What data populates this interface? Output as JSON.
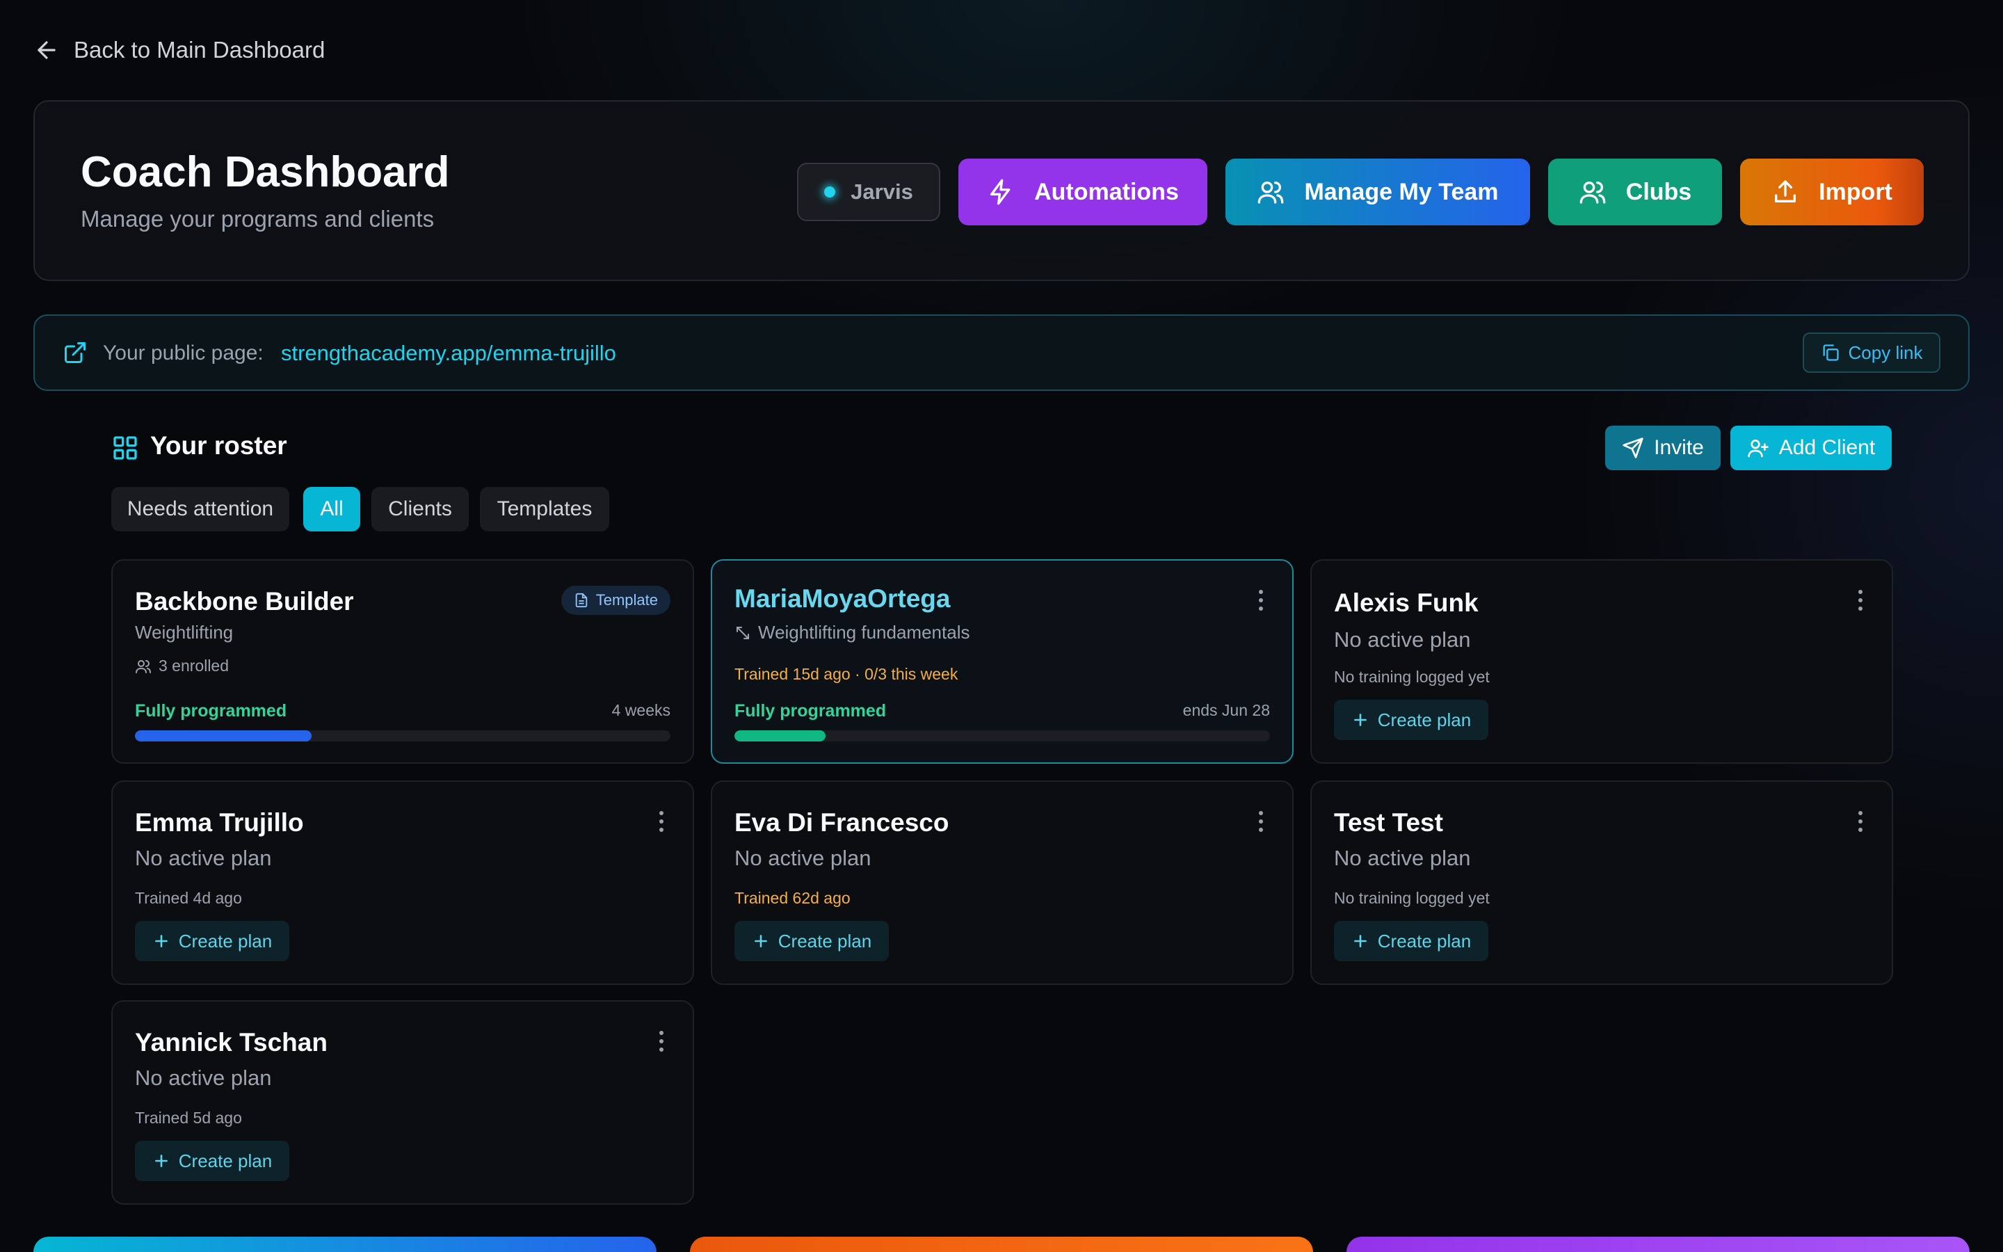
{
  "back_link": {
    "label": "Back to Main Dashboard"
  },
  "header": {
    "title": "Coach Dashboard",
    "subtitle": "Manage your programs and clients",
    "buttons": {
      "jarvis": "Jarvis",
      "automations": "Automations",
      "manage_team": "Manage My Team",
      "clubs": "Clubs",
      "import": "Import"
    }
  },
  "public_page": {
    "label": "Your public page:",
    "url": "strengthacademy.app/emma-trujillo",
    "copy_label": "Copy link"
  },
  "roster": {
    "title": "Your roster",
    "invite_label": "Invite",
    "add_client_label": "Add Client",
    "filters": [
      "Needs attention",
      "All",
      "Clients",
      "Templates"
    ],
    "active_filter": "All",
    "cards": [
      {
        "name": "Backbone Builder",
        "badge": "Template",
        "subtitle": "Weightlifting",
        "enrolled": "3 enrolled",
        "status": "Fully programmed",
        "right_text": "4 weeks",
        "progress": 0.33
      },
      {
        "name": "MariaMoyaOrtega",
        "subtitle": "Weightlifting fundamentals",
        "meta": "Trained 15d ago · 0/3 this week",
        "status": "Fully programmed",
        "right_text": "ends Jun 28",
        "progress": 0.17
      },
      {
        "name": "Alexis Funk",
        "plan": "No active plan",
        "trained": "No training logged yet",
        "action": "Create plan"
      },
      {
        "name": "Emma Trujillo",
        "plan": "No active plan",
        "trained": "Trained 4d ago",
        "action": "Create plan"
      },
      {
        "name": "Eva Di Francesco",
        "plan": "No active plan",
        "trained": "Trained 62d ago",
        "action": "Create plan"
      },
      {
        "name": "Test Test",
        "plan": "No active plan",
        "trained": "No training logged yet",
        "action": "Create plan"
      },
      {
        "name": "Yannick Tschan",
        "plan": "No active plan",
        "trained": "Trained 5d ago",
        "action": "Create plan"
      }
    ]
  },
  "colors": {
    "accent": "#06b6d4",
    "automations": "#9333ea",
    "clubs": "#0f9f7a",
    "import": "#ea580c",
    "status_green": "#34d399",
    "warning_amber": "#f5b041"
  }
}
